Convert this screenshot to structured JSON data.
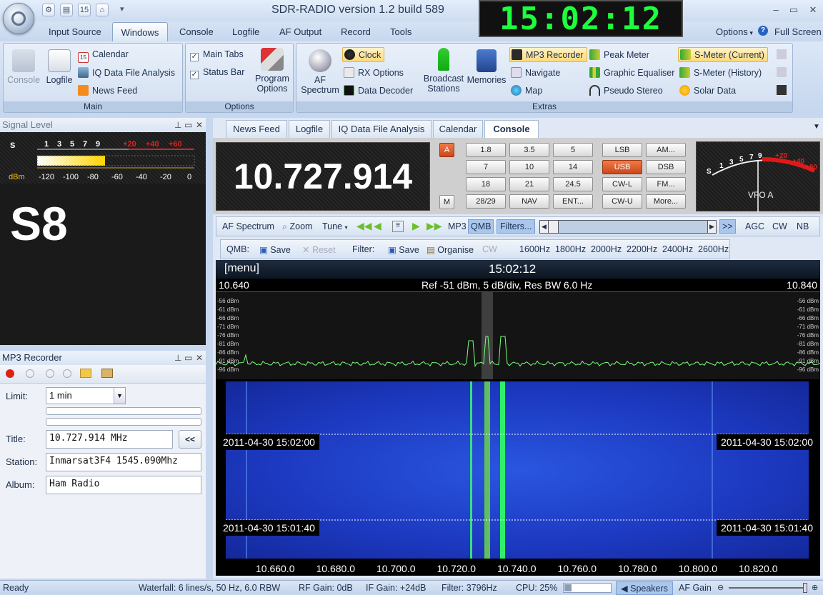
{
  "app": {
    "title": "SDR-RADIO version 1.2  build 589",
    "clock": "15:02:12"
  },
  "window_controls": {
    "minimize": "–",
    "maximize": "▭",
    "close": "✕"
  },
  "quick_access": [
    "gear-icon",
    "window-icon",
    "calendar-icon",
    "home-icon",
    "dropdown-icon"
  ],
  "menu": {
    "items": [
      "Input Source",
      "Windows",
      "Console",
      "Logfile",
      "AF Output",
      "Record",
      "Tools"
    ],
    "options": "Options",
    "fullscreen": "Full Screen"
  },
  "ribbon": {
    "main": {
      "caption": "Main",
      "console": "Console",
      "logfile": "Logfile",
      "calendar": "Calendar",
      "iq": "IQ Data File Analysis",
      "news": "News Feed"
    },
    "options": {
      "caption": "Options",
      "main_tabs": "Main Tabs",
      "status_bar": "Status Bar",
      "program_options_1": "Program",
      "program_options_2": "Options"
    },
    "extras": {
      "caption": "Extras",
      "af_spectrum_1": "AF",
      "af_spectrum_2": "Spectrum",
      "clock": "Clock",
      "rx_options": "RX Options",
      "data_decoder": "Data Decoder",
      "broadcast_1": "Broadcast",
      "broadcast_2": "Stations",
      "memories": "Memories",
      "mp3_recorder": "MP3 Recorder",
      "navigate": "Navigate",
      "map": "Map",
      "peak_meter": "Peak Meter",
      "graphic_eq": "Graphic Equaliser",
      "pseudo_stereo": "Pseudo Stereo",
      "smeter_current": "S-Meter (Current)",
      "smeter_history": "S-Meter (History)",
      "solar_data": "Solar Data"
    }
  },
  "signal_panel": {
    "title": "Signal Level",
    "big": "S8",
    "scale_top": [
      "S",
      "1",
      "3",
      "5",
      "7",
      "9",
      "+20",
      "+40",
      "+60"
    ],
    "scale_bottom": [
      "dBm",
      "-120",
      "-100",
      "-80",
      "-60",
      "-40",
      "-20",
      "0"
    ],
    "level_fraction": 0.43
  },
  "mp3_panel": {
    "title": "MP3 Recorder",
    "limit_label": "Limit:",
    "limit_value": "1 min",
    "title_label": "Title:",
    "title_value": "10.727.914 MHz",
    "back_btn": "<<",
    "station_label": "Station:",
    "station_value": "Inmarsat3F4 1545.090Mhz",
    "album_label": "Album:",
    "album_value": "Ham Radio"
  },
  "doc_tabs": [
    "News Feed",
    "Logfile",
    "IQ Data File Analysis",
    "Calendar",
    "Console"
  ],
  "console": {
    "frequency": "10.727.914",
    "a_btn": "A",
    "m_btn": "M",
    "bands": [
      "1.8",
      "3.5",
      "5",
      "7",
      "10",
      "14",
      "18",
      "21",
      "24.5",
      "28/29",
      "NAV",
      "ENT..."
    ],
    "modes": [
      "LSB",
      "AM...",
      "USB",
      "DSB",
      "CW-L",
      "FM...",
      "CW-U",
      "More..."
    ],
    "vfo": "VFO A",
    "smeter_labels": [
      "S",
      "1",
      "3",
      "5",
      "7",
      "9",
      "+20",
      "+40",
      "+60"
    ]
  },
  "toolbar1": {
    "af_spectrum": "AF Spectrum",
    "zoom": "Zoom",
    "tune": "Tune",
    "mp3": "MP3",
    "qmb": "QMB",
    "filters": "Filters...",
    "more": ">>",
    "agc": "AGC",
    "cw": "CW",
    "nb": "NB"
  },
  "toolbar2": {
    "qmb": "QMB:",
    "save": "Save",
    "reset": "Reset",
    "filter": "Filter:",
    "save2": "Save",
    "organise": "Organise",
    "cw": "CW",
    "filters": [
      "1600Hz",
      "1800Hz",
      "2000Hz",
      "2200Hz",
      "2400Hz",
      "2600Hz"
    ]
  },
  "spectrum": {
    "menu": "[menu]",
    "time": "15:02:12",
    "left_freq": "10.640",
    "right_freq": "10.840",
    "ref": "Ref -51 dBm,  5 dB/div,  Res BW 6.0 Hz",
    "db_labels": [
      "-56 dBm",
      "-61 dBm",
      "-66 dBm",
      "-71 dBm",
      "-76 dBm",
      "-81 dBm",
      "-86 dBm",
      "-91 dBm",
      "-96 dBm"
    ],
    "waterfall_times": [
      "2011-04-30  15:02:00",
      "2011-04-30  15:01:40"
    ],
    "axis": [
      "10.660.0",
      "10.680.0",
      "10.700.0",
      "10.720.0",
      "10.740.0",
      "10.760.0",
      "10.780.0",
      "10.800.0",
      "10.820.0"
    ]
  },
  "status": {
    "ready": "Ready",
    "waterfall": "Waterfall: 6 lines/s, 50 Hz, 6.0 RBW",
    "rf_gain": "RF Gain: 0dB",
    "if_gain": "IF Gain: +24dB",
    "filter": "Filter: 3796Hz",
    "cpu": "CPU: 25%",
    "speakers": "Speakers",
    "af_gain": "AF Gain"
  }
}
